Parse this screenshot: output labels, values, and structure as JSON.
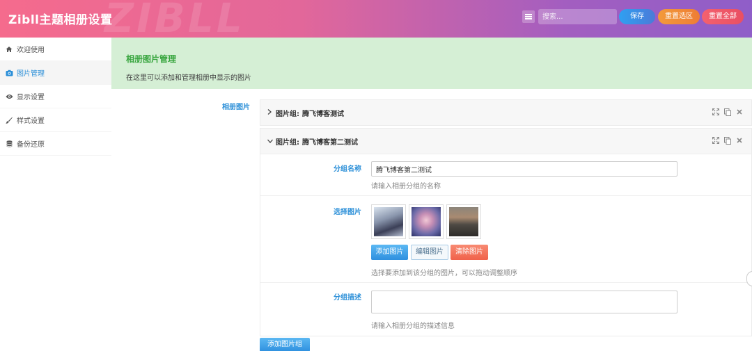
{
  "header": {
    "title": "Zibll主题相册设置",
    "watermark": "ZIBLL",
    "search_placeholder": "搜索...",
    "save_label": "保存",
    "reset_section_label": "重置选区",
    "reset_all_label": "重置全部"
  },
  "sidebar": {
    "items": [
      {
        "label": "欢迎使用",
        "icon": "home-icon"
      },
      {
        "label": "图片管理",
        "icon": "camera-icon",
        "active": true
      },
      {
        "label": "显示设置",
        "icon": "eye-icon"
      },
      {
        "label": "样式设置",
        "icon": "brush-icon"
      },
      {
        "label": "备份还原",
        "icon": "database-icon"
      }
    ]
  },
  "section": {
    "title": "相册图片管理",
    "description": "在这里可以添加和管理相册中显示的图片"
  },
  "field_label": "相册图片",
  "groups": [
    {
      "prefix": "图片组:",
      "name": "腾飞博客测试",
      "expanded": false
    },
    {
      "prefix": "图片组:",
      "name": "腾飞博客第二测试",
      "expanded": true
    }
  ],
  "group_form": {
    "name_label": "分组名称",
    "name_value": "腾飞博客第二测试",
    "name_help": "请输入相册分组的名称",
    "images_label": "选择图片",
    "add_image_label": "添加图片",
    "edit_image_label": "编辑图片",
    "clear_image_label": "清除图片",
    "images_help": "选择要添加到该分组的图片，可以拖动调整顺序",
    "desc_label": "分组描述",
    "desc_value": "",
    "desc_help": "请输入相册分组的描述信息"
  },
  "add_group_label": "添加图片组",
  "colors": {
    "accent": "#2b8fd8",
    "section_bg": "#d5efd5",
    "section_title": "#37a53e"
  }
}
